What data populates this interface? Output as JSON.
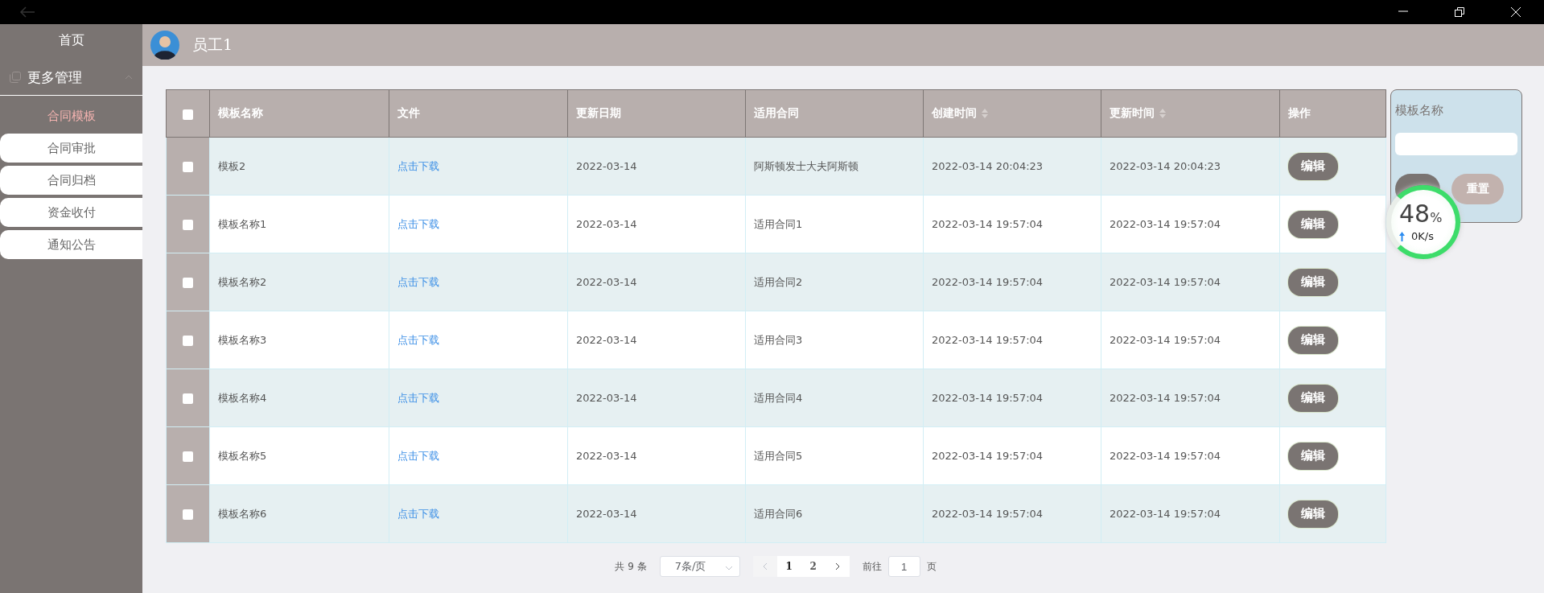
{
  "header": {
    "user": "员工1"
  },
  "sidebar": {
    "home": "首页",
    "group": {
      "label": "更多管理",
      "expanded": true,
      "items": [
        {
          "label": "合同模板",
          "selected": true
        },
        {
          "label": "合同审批",
          "selected": false
        },
        {
          "label": "合同归档",
          "selected": false
        },
        {
          "label": "资金收付",
          "selected": false
        },
        {
          "label": "通知公告",
          "selected": false
        }
      ]
    }
  },
  "table": {
    "select_all_checked": false,
    "columns": [
      {
        "label": "模板名称",
        "sortable": false
      },
      {
        "label": "文件",
        "sortable": false
      },
      {
        "label": "更新日期",
        "sortable": false
      },
      {
        "label": "适用合同",
        "sortable": false
      },
      {
        "label": "创建时间",
        "sortable": true
      },
      {
        "label": "更新时间",
        "sortable": true
      },
      {
        "label": "操作",
        "sortable": false
      }
    ],
    "rows": [
      {
        "checked": false,
        "name": "模板2",
        "file": "点击下载",
        "date": "2022-03-14",
        "contract": "阿斯顿发士大夫阿斯顿",
        "created": "2022-03-14 20:04:23",
        "updated": "2022-03-14 20:04:23",
        "action": "编辑"
      },
      {
        "checked": false,
        "name": "模板名称1",
        "file": "点击下载",
        "date": "2022-03-14",
        "contract": "适用合同1",
        "created": "2022-03-14 19:57:04",
        "updated": "2022-03-14 19:57:04",
        "action": "编辑"
      },
      {
        "checked": false,
        "name": "模板名称2",
        "file": "点击下载",
        "date": "2022-03-14",
        "contract": "适用合同2",
        "created": "2022-03-14 19:57:04",
        "updated": "2022-03-14 19:57:04",
        "action": "编辑"
      },
      {
        "checked": false,
        "name": "模板名称3",
        "file": "点击下载",
        "date": "2022-03-14",
        "contract": "适用合同3",
        "created": "2022-03-14 19:57:04",
        "updated": "2022-03-14 19:57:04",
        "action": "编辑"
      },
      {
        "checked": false,
        "name": "模板名称4",
        "file": "点击下载",
        "date": "2022-03-14",
        "contract": "适用合同4",
        "created": "2022-03-14 19:57:04",
        "updated": "2022-03-14 19:57:04",
        "action": "编辑"
      },
      {
        "checked": false,
        "name": "模板名称5",
        "file": "点击下载",
        "date": "2022-03-14",
        "contract": "适用合同5",
        "created": "2022-03-14 19:57:04",
        "updated": "2022-03-14 19:57:04",
        "action": "编辑"
      },
      {
        "checked": false,
        "name": "模板名称6",
        "file": "点击下载",
        "date": "2022-03-14",
        "contract": "适用合同6",
        "created": "2022-03-14 19:57:04",
        "updated": "2022-03-14 19:57:04",
        "action": "编辑"
      }
    ]
  },
  "search": {
    "label": "模板名称",
    "reset_button": "重置"
  },
  "speed_widget": {
    "percent": "48",
    "unit": "%",
    "speed": "0K/s"
  },
  "pagination": {
    "total": "共 9 条",
    "page_size": "7条/页",
    "pages": [
      {
        "label": "1",
        "selected": true
      },
      {
        "label": "2",
        "selected": false
      }
    ],
    "goto_label": "前往",
    "goto_value": "1",
    "page_suffix": "页"
  }
}
